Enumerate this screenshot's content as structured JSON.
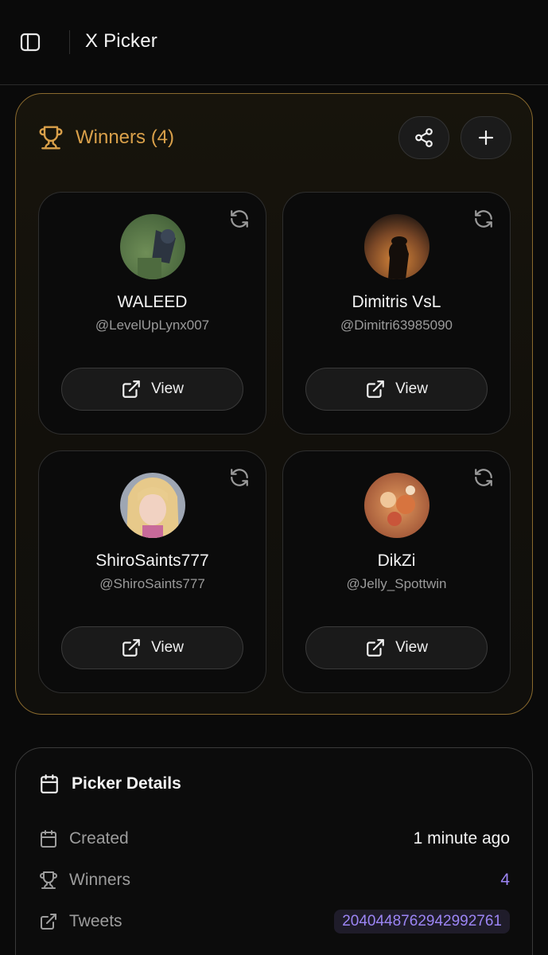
{
  "header": {
    "title": "X Picker"
  },
  "winners": {
    "title": "Winners (4)",
    "accent": "#d9a04a",
    "items": [
      {
        "name": "WALEED",
        "handle": "@LevelUpLynx007",
        "view_label": "View",
        "avatar": "green-scene-avatar"
      },
      {
        "name": "Dimitris VsL",
        "handle": "@Dimitri63985090",
        "view_label": "View",
        "avatar": "sunset-silhouette-avatar"
      },
      {
        "name": "ShiroSaints777",
        "handle": "@ShiroSaints777",
        "view_label": "View",
        "avatar": "blonde-character-avatar"
      },
      {
        "name": "DikZi",
        "handle": "@Jelly_Spottwin",
        "view_label": "View",
        "avatar": "food-plate-avatar"
      }
    ]
  },
  "details": {
    "title": "Picker Details",
    "rows": [
      {
        "label": "Created",
        "value": "1 minute ago",
        "icon": "calendar-icon"
      },
      {
        "label": "Winners",
        "value": "4",
        "icon": "trophy-icon"
      },
      {
        "label": "Tweets",
        "value": "2040448762942992761",
        "icon": "external-link-icon"
      }
    ]
  },
  "colors": {
    "background": "#0a0a0a",
    "gold": "#d9a04a",
    "purple": "#9c85f5"
  }
}
